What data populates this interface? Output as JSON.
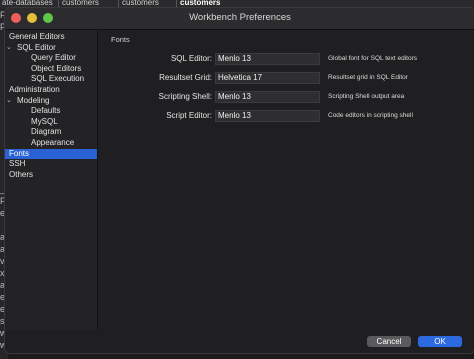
{
  "background_app": {
    "tabs": [
      {
        "label": "ate-databases",
        "active": false
      },
      {
        "label": "customers",
        "active": false
      },
      {
        "label": "customers",
        "active": false
      },
      {
        "label": "customers",
        "active": true
      }
    ],
    "edge_letters": [
      "F",
      "F",
      "_",
      "F",
      "e",
      "a",
      "a",
      "v",
      "x",
      "a",
      "e",
      "e",
      "s",
      "w",
      "w"
    ]
  },
  "window": {
    "title": "Workbench Preferences"
  },
  "sidebar": {
    "items": [
      {
        "label": "General Editors",
        "level": 1,
        "expandable": false,
        "selected": false
      },
      {
        "label": "SQL Editor",
        "level": 1,
        "expandable": true,
        "selected": false
      },
      {
        "label": "Query Editor",
        "level": 2,
        "expandable": false,
        "selected": false
      },
      {
        "label": "Object Editors",
        "level": 2,
        "expandable": false,
        "selected": false
      },
      {
        "label": "SQL Execution",
        "level": 2,
        "expandable": false,
        "selected": false
      },
      {
        "label": "Administration",
        "level": 1,
        "expandable": false,
        "selected": false
      },
      {
        "label": "Modeling",
        "level": 1,
        "expandable": true,
        "selected": false
      },
      {
        "label": "Defaults",
        "level": 2,
        "expandable": false,
        "selected": false
      },
      {
        "label": "MySQL",
        "level": 2,
        "expandable": false,
        "selected": false
      },
      {
        "label": "Diagram",
        "level": 2,
        "expandable": false,
        "selected": false
      },
      {
        "label": "Appearance",
        "level": 2,
        "expandable": false,
        "selected": false
      },
      {
        "label": "Fonts",
        "level": 1,
        "expandable": false,
        "selected": true
      },
      {
        "label": "SSH",
        "level": 1,
        "expandable": false,
        "selected": false
      },
      {
        "label": "Others",
        "level": 1,
        "expandable": false,
        "selected": false
      }
    ]
  },
  "fonts": {
    "section_title": "Fonts",
    "rows": [
      {
        "label": "SQL Editor:",
        "value": "Menlo 13",
        "description": "Global font for SQL text editors"
      },
      {
        "label": "Resultset Grid:",
        "value": "Helvetica 17",
        "description": "Resultset grid in SQL Editor"
      },
      {
        "label": "Scripting Shell:",
        "value": "Menlo 13",
        "description": "Scripting Shell output area"
      },
      {
        "label": "Script Editor:",
        "value": "Menlo 13",
        "description": "Code editors in scripting shell"
      }
    ]
  },
  "buttons": {
    "cancel": "Cancel",
    "ok": "OK"
  },
  "colors": {
    "accent": "#2b62d3",
    "ok_button": "#2c6ae0",
    "close": "#ec5f5a",
    "minimize": "#e3bf3b",
    "zoom": "#5fc649"
  }
}
